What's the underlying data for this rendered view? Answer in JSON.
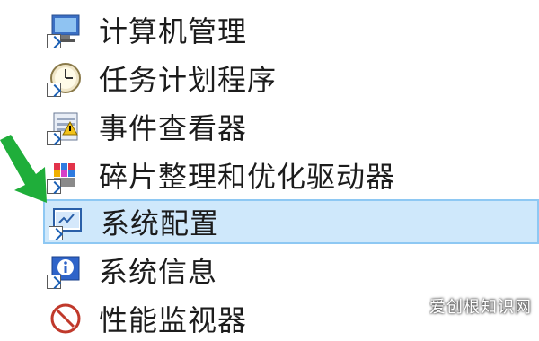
{
  "menu": {
    "items": [
      {
        "label": "计算机管理",
        "icon": "computer-management-icon"
      },
      {
        "label": "任务计划程序",
        "icon": "task-scheduler-icon"
      },
      {
        "label": "事件查看器",
        "icon": "event-viewer-icon"
      },
      {
        "label": "碎片整理和优化驱动器",
        "icon": "defragment-icon"
      },
      {
        "label": "系统配置",
        "icon": "system-configuration-icon",
        "selected": true
      },
      {
        "label": "系统信息",
        "icon": "system-information-icon"
      },
      {
        "label": "性能监视器",
        "icon": "performance-monitor-icon"
      }
    ]
  },
  "watermark": "爱创根知识网",
  "colors": {
    "selection_bg": "#cfe8fb",
    "selection_border": "#8ec8f3",
    "arrow": "#1fae3a"
  }
}
